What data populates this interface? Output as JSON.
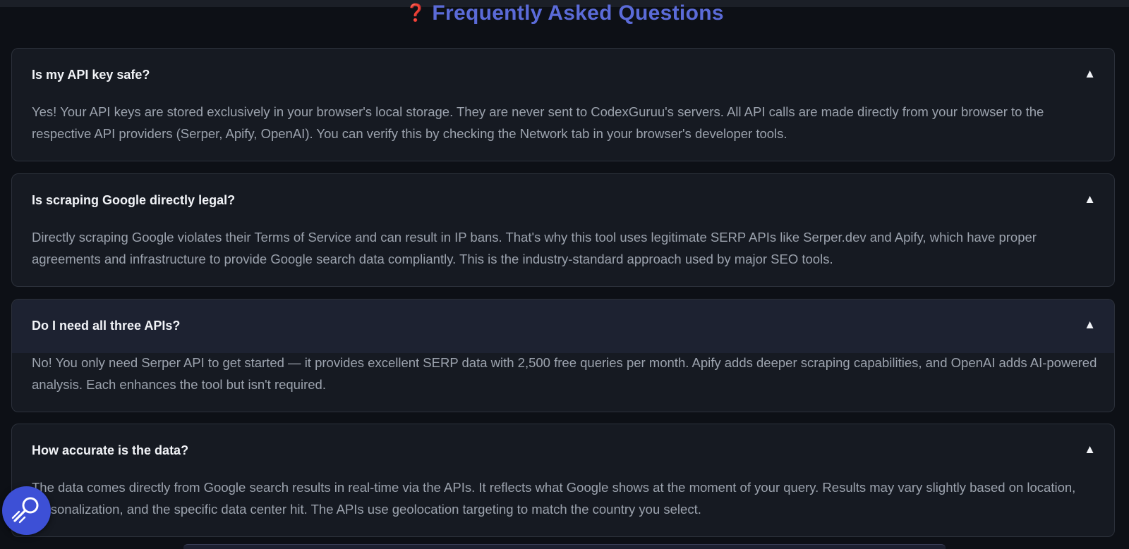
{
  "faq": {
    "icon": "question-mark-icon",
    "icon_glyph": "❓",
    "title": "Frequently Asked Questions",
    "items": [
      {
        "question": "Is my API key safe?",
        "toggle": "▲",
        "answer": "Yes! Your API keys are stored exclusively in your browser's local storage. They are never sent to CodexGuruu's servers. All API calls are made directly from your browser to the respective API providers (Serper, Apify, OpenAI). You can verify this by checking the Network tab in your browser's developer tools."
      },
      {
        "question": "Is scraping Google directly legal?",
        "toggle": "▲",
        "answer": "Directly scraping Google violates their Terms of Service and can result in IP bans. That's why this tool uses legitimate SERP APIs like Serper.dev and Apify, which have proper agreements and infrastructure to provide Google search data compliantly. This is the industry-standard approach used by major SEO tools."
      },
      {
        "question": "Do I need all three APIs?",
        "toggle": "▲",
        "answer": "No! You only need Serper API to get started — it provides excellent SERP data with 2,500 free queries per month. Apify adds deeper scraping capabilities, and OpenAI adds AI-powered analysis. Each enhances the tool but isn't required."
      },
      {
        "question": "How accurate is the data?",
        "toggle": "▲",
        "answer": "The data comes directly from Google search results in real-time via the APIs. It reflects what Google shows at the moment of your query. Results may vary slightly based on location, personalization, and the specific data center hit. The APIs use geolocation targeting to match the country you select."
      }
    ]
  },
  "fab": {
    "icon": "magic-wand-icon"
  },
  "colors": {
    "background": "#0d1016",
    "card": "#161a22",
    "card_hover": "#1d2231",
    "accent": "#5b6bd8",
    "fab": "#3d50d6"
  }
}
